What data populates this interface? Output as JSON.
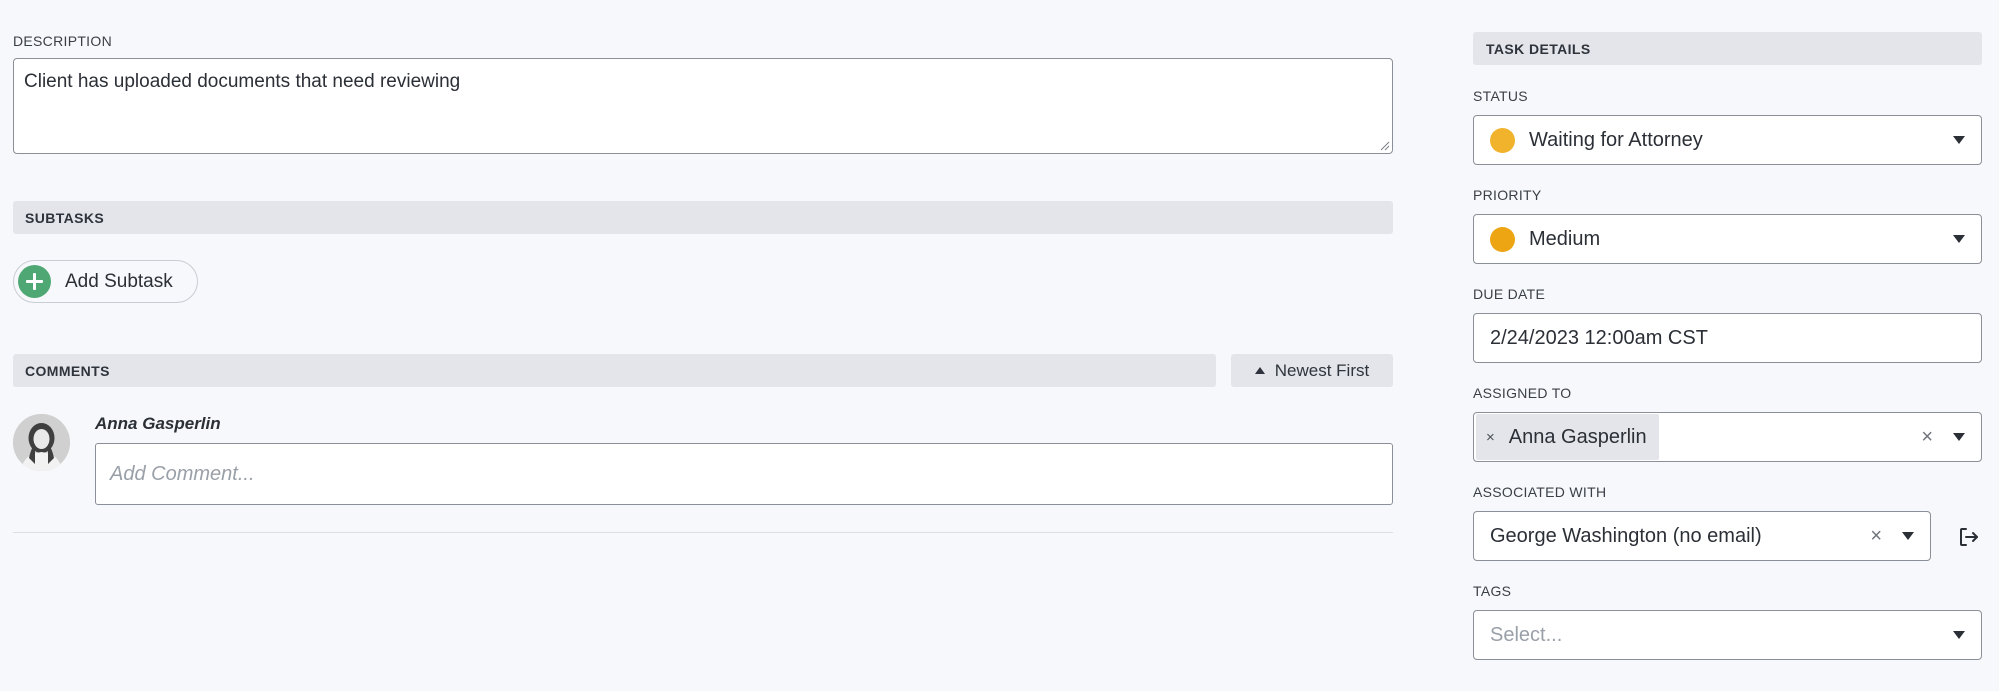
{
  "description": {
    "label": "DESCRIPTION",
    "value": "Client has uploaded documents that need reviewing"
  },
  "subtasks": {
    "header": "SUBTASKS",
    "add_label": "Add Subtask"
  },
  "comments": {
    "header": "COMMENTS",
    "sort_label": "Newest First",
    "author": "Anna Gasperlin",
    "input_placeholder": "Add Comment..."
  },
  "task_details": {
    "header": "TASK DETAILS",
    "status": {
      "label": "STATUS",
      "value": "Waiting for Attorney",
      "color": "#f2b32c"
    },
    "priority": {
      "label": "PRIORITY",
      "value": "Medium",
      "color": "#eda513"
    },
    "due_date": {
      "label": "DUE DATE",
      "value": "2/24/2023 12:00am CST"
    },
    "assigned_to": {
      "label": "ASSIGNED TO",
      "chip": "Anna Gasperlin",
      "chip_remove": "×",
      "clear": "×"
    },
    "associated_with": {
      "label": "ASSOCIATED WITH",
      "value": "George Washington (no email)",
      "clear": "×"
    },
    "tags": {
      "label": "TAGS",
      "placeholder": "Select..."
    }
  },
  "colors": {
    "add_button": "#4fa874",
    "section_bg": "#e3e5ea",
    "page_bg": "#f7f8fb"
  },
  "icons": {
    "add": "plus-circle-icon",
    "sort": "caret-up-icon",
    "dropdown": "caret-down-icon",
    "open": "open-external-icon",
    "resize": "resize-grip-icon"
  }
}
